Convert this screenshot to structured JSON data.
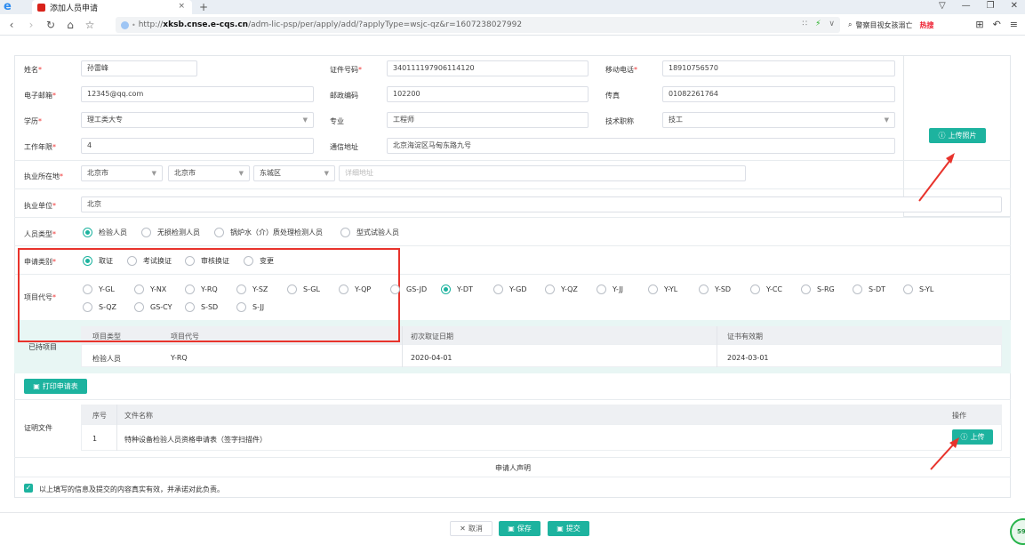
{
  "browser": {
    "tab_title": "添加人员申请",
    "tab_close": "×",
    "new_tab": "+",
    "url_proto": "http://",
    "url_host": "xksb.cnse.e-cqs.cn",
    "url_path": "/adm-lic-psp/per/apply/add/?applyType=wsjc-qz&r=1607238027992",
    "search_text": "警察目视女孩溺亡",
    "search_hot": "热搜",
    "window_controls": [
      "▽",
      "—",
      "❐",
      "✕"
    ]
  },
  "form": {
    "name": {
      "label": "姓名",
      "value": "孙雷峰"
    },
    "id_number": {
      "label": "证件号码",
      "value": "340111197906114120"
    },
    "mobile": {
      "label": "移动电话",
      "value": "18910756570"
    },
    "email": {
      "label": "电子邮箱",
      "value": "12345@qq.com"
    },
    "postcode": {
      "label": "邮政编码",
      "value": "102200"
    },
    "fax": {
      "label": "传真",
      "value": "01082261764"
    },
    "education": {
      "label": "学历",
      "value": "理工类大专"
    },
    "major": {
      "label": "专业",
      "value": "工程师"
    },
    "title": {
      "label": "技术职称",
      "value": "技工"
    },
    "work_years": {
      "label": "工作年限",
      "value": "4"
    },
    "address": {
      "label": "通信地址",
      "value": "北京海淀区马甸东路九号"
    },
    "practice_location": {
      "label": "执业所在地",
      "province": "北京市",
      "city": "北京市",
      "district": "东城区",
      "detail_placeholder": "详细地址"
    },
    "employer": {
      "label": "执业单位",
      "value": "北京"
    },
    "upload_photo_label": "上传照片",
    "person_type": {
      "label": "人员类型",
      "options": [
        "检验人员",
        "无损检测人员",
        "锅炉水（介）质处理检测人员",
        "型式试验人员"
      ],
      "selected": 0
    },
    "apply_type": {
      "label": "申请类别",
      "options": [
        "取证",
        "考试换证",
        "审核换证",
        "变更"
      ],
      "selected": 0
    },
    "project_code": {
      "label": "项目代号",
      "row1": [
        "Y-GL",
        "Y-NX",
        "Y-RQ",
        "Y-SZ",
        "S-GL",
        "Y-QP",
        "GS-JD",
        "Y-DT",
        "Y-GD",
        "Y-QZ",
        "Y-JJ",
        "Y-YL",
        "Y-SD",
        "Y-CC",
        "S-RG",
        "S-DT",
        "S-YL"
      ],
      "row2": [
        "S-QZ",
        "GS-CY",
        "S-SD",
        "S-JJ"
      ],
      "selected": "Y-DT"
    },
    "existing": {
      "label": "已持项目",
      "headers": [
        "项目类型",
        "项目代号",
        "初次取证日期",
        "证书有效期"
      ],
      "rows": [
        [
          "检验人员",
          "Y-RQ",
          "2020-04-01",
          "2024-03-01"
        ]
      ]
    },
    "print_button": "打印申请表",
    "documents": {
      "label": "证明文件",
      "headers": [
        "序号",
        "文件名称",
        "操作"
      ],
      "rows": [
        [
          "1",
          "特种设备检验人员资格申请表（签字扫描件）"
        ]
      ],
      "upload_label": "上传"
    },
    "declaration_title": "申请人声明",
    "declaration_text": "以上填写的信息及提交的内容真实有效，并承诺对此负责。",
    "cancel_label": "取消",
    "save_label": "保存",
    "submit_label": "提交",
    "corner_badge": "59"
  },
  "colors": {
    "accent": "#1db39f",
    "annotation": "#e8332c"
  }
}
